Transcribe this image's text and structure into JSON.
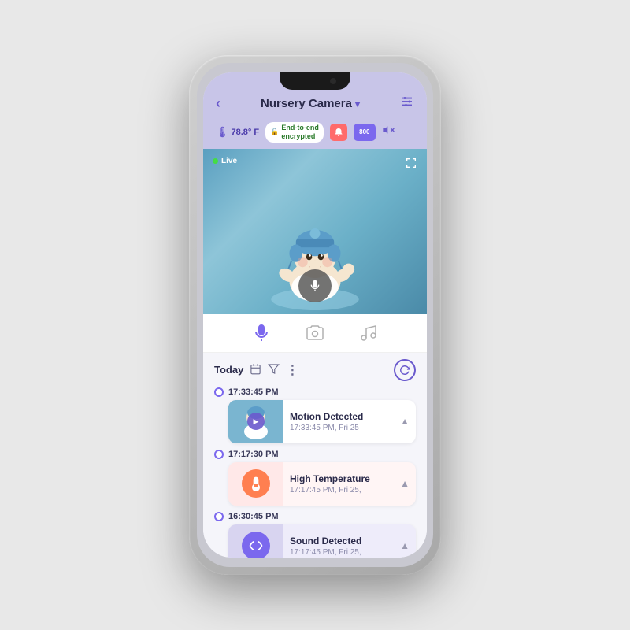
{
  "header": {
    "back_label": "‹",
    "title": "Nursery Camera",
    "title_chevron": "▾",
    "settings_icon": "⚙"
  },
  "status_bar": {
    "temperature": "78.8° F",
    "encryption_label": "End-to-end\nencrypted",
    "quality_label": "800",
    "mute_icon": "🔇"
  },
  "video": {
    "live_label": "Live",
    "fullscreen_icon": "⛶"
  },
  "controls": {
    "mic_label": "🎙",
    "camera_label": "📷",
    "music_label": "♪"
  },
  "timeline": {
    "today_label": "Today",
    "calendar_icon": "📅",
    "filter_icon": "⚙",
    "more_icon": "⋮",
    "refresh_icon": "↻"
  },
  "events": [
    {
      "time": "17:33:45 PM",
      "type": "motion",
      "title": "Motion Detected",
      "subtitle": "17:33:45 PM, Fri 25",
      "has_thumb": true
    },
    {
      "time": "17:17:30 PM",
      "type": "temperature",
      "title": "High Temperature",
      "subtitle": "17:17:45 PM, Fri 25,",
      "has_thumb": false
    },
    {
      "time": "16:30:45 PM",
      "type": "sound",
      "title": "Sound Detected",
      "subtitle": "17:17:45 PM, Fri 25,",
      "has_thumb": false
    }
  ]
}
